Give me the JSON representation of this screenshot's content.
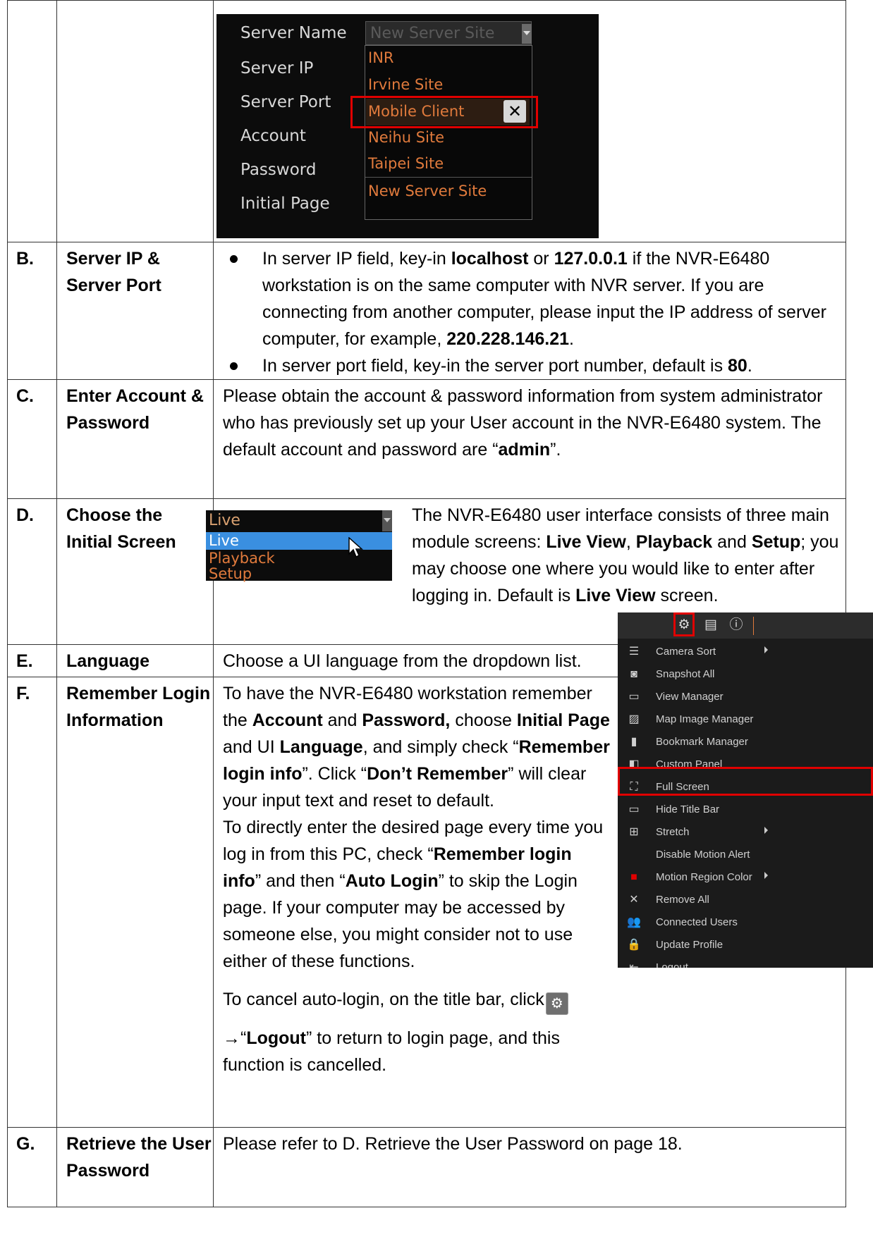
{
  "login_shot": {
    "labels": [
      "Server Name",
      "Server IP",
      "Server Port",
      "Account",
      "Password",
      "Initial Page"
    ],
    "server_name_value": "New Server Site",
    "dropdown_items": [
      "INR",
      "Irvine Site",
      "Mobile Client",
      "Neihu Site",
      "Taipei Site",
      "New Server Site"
    ],
    "highlighted_item": "Mobile Client",
    "close_glyph": "✕"
  },
  "rows": {
    "B": {
      "id": "B.",
      "name": "Server IP & Server Port",
      "bullet1_a": "In server IP field, key-in ",
      "bullet1_b": "localhost",
      "bullet1_c": " or ",
      "bullet1_d": "127.0.0.1",
      "bullet1_e": " if the NVR-E6480 workstation is on the same computer with NVR server. If you are connecting from another computer, please input the IP address of server computer, for example, ",
      "bullet1_f": "220.228.146.21",
      "bullet1_g": ".",
      "bullet2_a": "In server port field, key-in the server port number, default is ",
      "bullet2_b": "80",
      "bullet2_c": "."
    },
    "C": {
      "id": "C.",
      "name": "Enter Account & Password",
      "text_a": "Please obtain the account & password information from system administrator who has previously set up your User account in the NVR-E6480 system. The default account and password are “",
      "text_b": "admin",
      "text_c": "”."
    },
    "D": {
      "id": "D.",
      "name": "Choose the Initial Screen",
      "dropdown_top": "Live",
      "dropdown_options": [
        "Live",
        "Playback",
        "Setup"
      ],
      "t1": "The NVR-E6480 user interface consists of three main module screens: ",
      "t2": "Live View",
      "t3": ", ",
      "t4": "Playback",
      "t5": " and ",
      "t6": "Setup",
      "t7": "; you may choose one where you would like to enter after logging in. Default is ",
      "t8": "Live View",
      "t9": " screen."
    },
    "E": {
      "id": "E.",
      "name": "Language",
      "text": "Choose a UI language from the dropdown list."
    },
    "F": {
      "id": "F.",
      "name": "Remember Login Information",
      "p1_a": "To have the NVR-E6480 workstation remember the ",
      "p1_b": "Account",
      "p1_c": " and ",
      "p1_d": "Password,",
      "p1_e": " choose ",
      "p1_f": "Initial Page",
      "p1_g": " and UI ",
      "p1_h": "Language",
      "p1_i": ", and simply check “",
      "p1_j": "Remember login info",
      "p1_k": "”. Click “",
      "p1_l": "Don’t Remember",
      "p1_m": "” will clear your input text and reset to default.",
      "p2_a": "To directly enter the desired page every time you log in from this PC, check “",
      "p2_b": "Remember login info",
      "p2_c": "” and then “",
      "p2_d": "Auto Login",
      "p2_e": "” to skip the Login page. If your computer may be accessed by someone else, you might consider not to use either of these functions.",
      "p3_a": "To cancel auto-login, on the title bar, click",
      "p3_b": "→“",
      "p3_c": "Logout",
      "p3_d": "” to return to login page, and this function is cancelled."
    },
    "G": {
      "id": "G.",
      "name": "Retrieve the User Password",
      "text": "Please refer to D. Retrieve the User Password on page 18."
    }
  },
  "menu_shot": {
    "items": [
      {
        "label": "Camera Sort",
        "icon": "list-icon",
        "glyph": "☰",
        "submenu": true
      },
      {
        "label": "Snapshot All",
        "icon": "camera-icon",
        "glyph": "◙",
        "submenu": false
      },
      {
        "label": "View Manager",
        "icon": "window-icon",
        "glyph": "▭",
        "submenu": false
      },
      {
        "label": "Map Image Manager",
        "icon": "image-icon",
        "glyph": "▨",
        "submenu": false
      },
      {
        "label": "Bookmark Manager",
        "icon": "bookmark-icon",
        "glyph": "▮",
        "submenu": false
      },
      {
        "label": "Custom Panel",
        "icon": "panel-icon",
        "glyph": "◧",
        "submenu": false
      },
      {
        "label": "Full Screen",
        "icon": "fullscreen-icon",
        "glyph": "⛶",
        "submenu": false
      },
      {
        "label": "Hide Title Bar",
        "icon": "titlebar-icon",
        "glyph": "▭",
        "submenu": false
      },
      {
        "label": "Stretch",
        "icon": "stretch-icon",
        "glyph": "⊞",
        "submenu": true
      },
      {
        "label": "Disable Motion Alert",
        "icon": "",
        "glyph": "",
        "submenu": false
      },
      {
        "label": "Motion Region Color",
        "icon": "color-square-icon",
        "glyph": "■",
        "submenu": true
      },
      {
        "label": "Remove All",
        "icon": "close-icon",
        "glyph": "✕",
        "submenu": false
      },
      {
        "label": "Connected Users",
        "icon": "users-icon",
        "glyph": "👥",
        "submenu": false
      },
      {
        "label": "Update Profile",
        "icon": "lock-icon",
        "glyph": "🔒",
        "submenu": false
      },
      {
        "label": "Logout",
        "icon": "logout-icon",
        "glyph": "⇤",
        "submenu": false
      }
    ]
  },
  "colors": {
    "highlight_red": "#e00000",
    "dropdown_orange": "#e07a3c",
    "selection_blue": "#3a8fe0"
  }
}
